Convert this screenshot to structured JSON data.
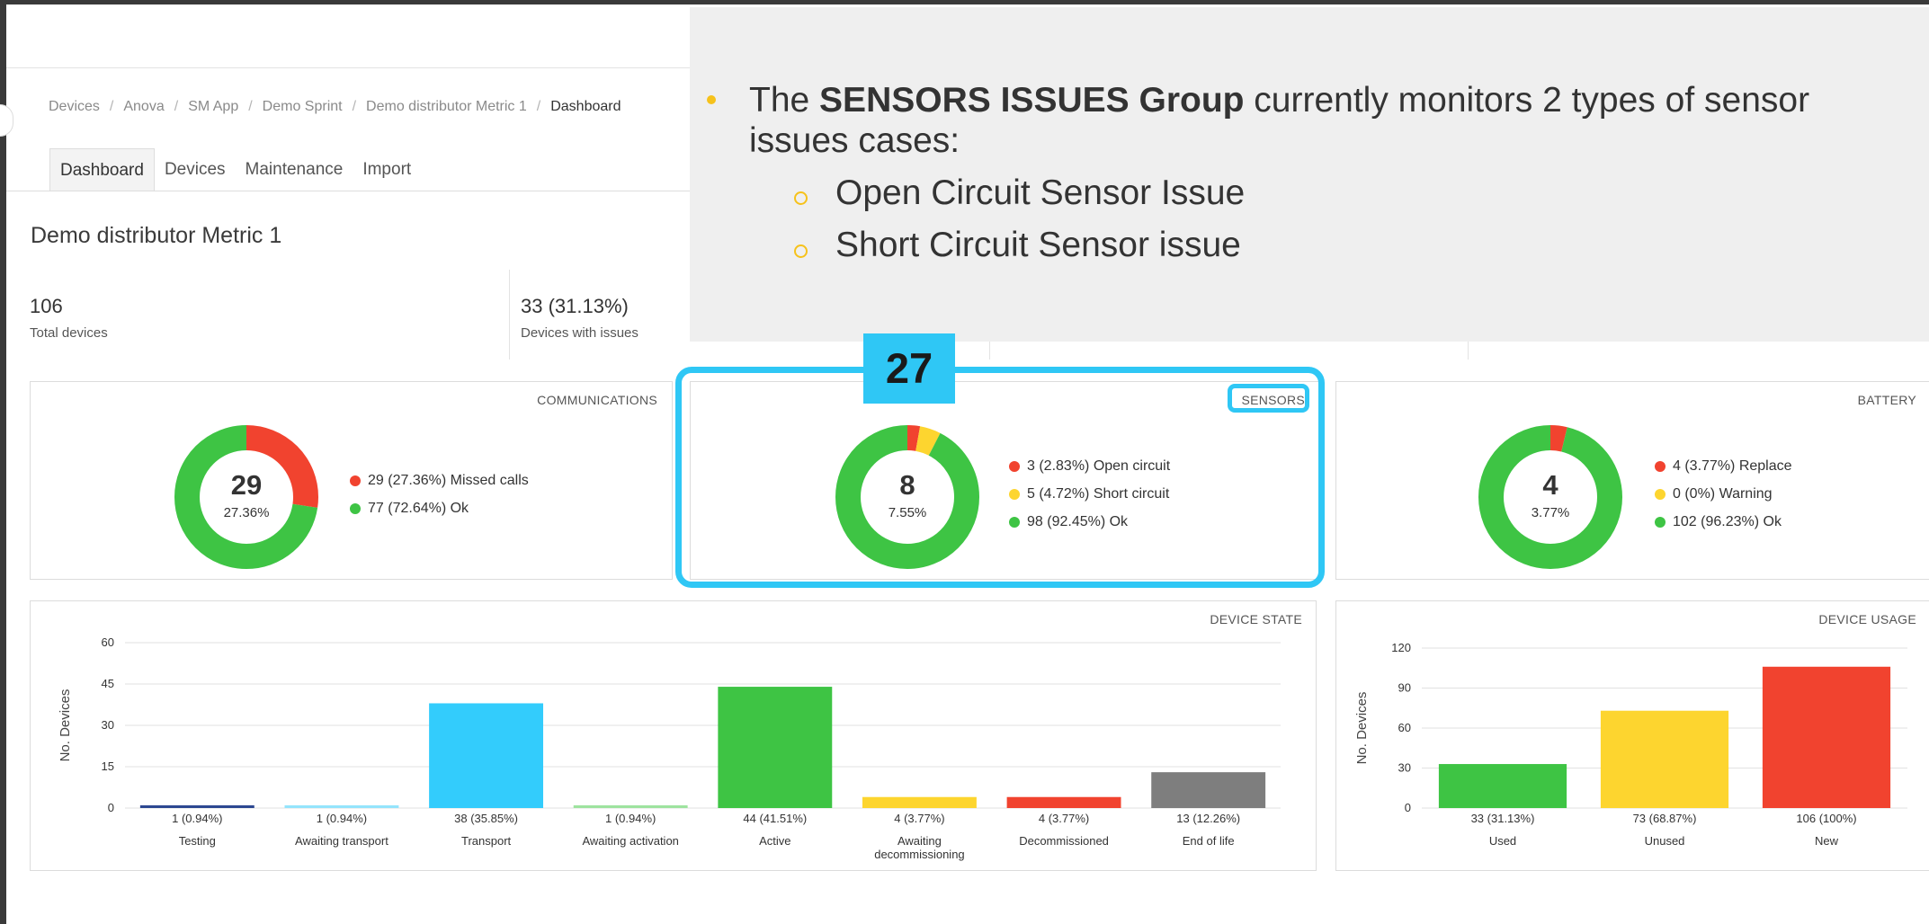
{
  "breadcrumb": [
    "Devices",
    "Anova",
    "SM App",
    "Demo Sprint",
    "Demo distributor Metric 1",
    "Dashboard"
  ],
  "breadcrumb_sep": "/",
  "tabs": [
    "Dashboard",
    "Devices",
    "Maintenance",
    "Import"
  ],
  "page_title": "Demo distributor Metric 1",
  "stats": {
    "total": {
      "value": "106",
      "label": "Total devices"
    },
    "issues": {
      "value": "33 (31.13%)",
      "label": "Devices with issues"
    }
  },
  "overlay": {
    "intro_pre": "The ",
    "intro_bold": "SENSORS ISSUES Group",
    "intro_post": " currently monitors 2 types of sensor",
    "intro_line2": "issues cases:",
    "items": [
      "Open Circuit Sensor Issue",
      "Short Circuit Sensor issue"
    ]
  },
  "badge": "27",
  "colors": {
    "red": "#f1432f",
    "green": "#3ec444",
    "yellow": "#fdd52f",
    "cyan": "#33ccfc",
    "navy": "#2d4891",
    "lightblue": "#94e4fc",
    "lightgreen": "#9ee39f",
    "gray": "#7e7e7e",
    "accent": "#f6c21b",
    "highlight": "#2fc7f5"
  },
  "communications": {
    "title": "COMMUNICATIONS",
    "center_value": "29",
    "center_pct": "27.36%",
    "legend": [
      "29 (27.36%) Missed calls",
      "77 (72.64%) Ok"
    ]
  },
  "sensors": {
    "title": "SENSORS",
    "center_value": "8",
    "center_pct": "7.55%",
    "legend": [
      "3 (2.83%) Open circuit",
      "5 (4.72%) Short circuit",
      "98 (92.45%) Ok"
    ]
  },
  "battery": {
    "title": "BATTERY",
    "center_value": "4",
    "center_pct": "3.77%",
    "legend": [
      "4 (3.77%) Replace",
      "0 (0%) Warning",
      "102 (96.23%) Ok"
    ]
  },
  "chart_data": [
    {
      "type": "pie",
      "title": "COMMUNICATIONS",
      "categories": [
        "Missed calls",
        "Ok"
      ],
      "values": [
        29,
        77
      ],
      "colors": [
        "#f1432f",
        "#3ec444"
      ]
    },
    {
      "type": "pie",
      "title": "SENSORS",
      "categories": [
        "Open circuit",
        "Short circuit",
        "Ok"
      ],
      "values": [
        3,
        5,
        98
      ],
      "colors": [
        "#f1432f",
        "#fdd52f",
        "#3ec444"
      ]
    },
    {
      "type": "pie",
      "title": "BATTERY",
      "categories": [
        "Replace",
        "Warning",
        "Ok"
      ],
      "values": [
        4,
        0,
        102
      ],
      "colors": [
        "#f1432f",
        "#fdd52f",
        "#3ec444"
      ]
    },
    {
      "type": "bar",
      "title": "DEVICE STATE",
      "ylabel": "No. Devices",
      "ylim": [
        0,
        60
      ],
      "yticks": [
        0,
        15,
        30,
        45,
        60
      ],
      "categories": [
        "Testing",
        "Awaiting transport",
        "Transport",
        "Awaiting activation",
        "Active",
        "Awaiting decommissioning",
        "Decommissioned",
        "End of life"
      ],
      "category_lines": [
        [
          "Testing"
        ],
        [
          "Awaiting transport"
        ],
        [
          "Transport"
        ],
        [
          "Awaiting activation"
        ],
        [
          "Active"
        ],
        [
          "Awaiting",
          "decommissioning"
        ],
        [
          "Decommissioned"
        ],
        [
          "End of life"
        ]
      ],
      "values": [
        1,
        1,
        38,
        1,
        44,
        4,
        4,
        13
      ],
      "value_labels": [
        "1 (0.94%)",
        "1 (0.94%)",
        "38 (35.85%)",
        "1 (0.94%)",
        "44 (41.51%)",
        "4 (3.77%)",
        "4 (3.77%)",
        "13 (12.26%)"
      ],
      "colors": [
        "#2d4891",
        "#94e4fc",
        "#33ccfc",
        "#9ee39f",
        "#3ec444",
        "#fdd52f",
        "#f1432f",
        "#7e7e7e"
      ]
    },
    {
      "type": "bar",
      "title": "DEVICE USAGE",
      "ylabel": "No. Devices",
      "ylim": [
        0,
        120
      ],
      "yticks": [
        0,
        30,
        60,
        90,
        120
      ],
      "categories": [
        "Used",
        "Unused",
        "New"
      ],
      "category_lines": [
        [
          "Used"
        ],
        [
          "Unused"
        ],
        [
          "New"
        ]
      ],
      "values": [
        33,
        73,
        106
      ],
      "value_labels": [
        "33 (31.13%)",
        "73 (68.87%)",
        "106 (100%)"
      ],
      "colors": [
        "#3ec444",
        "#fdd52f",
        "#f1432f"
      ]
    }
  ]
}
